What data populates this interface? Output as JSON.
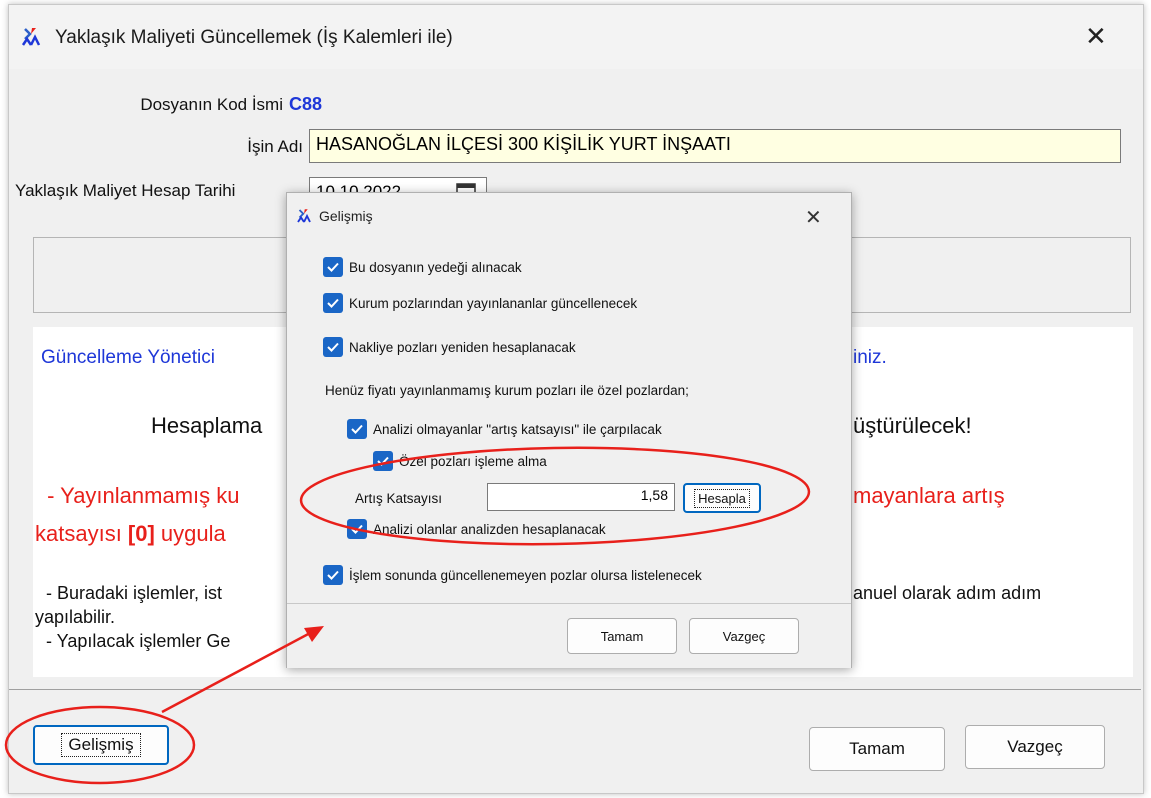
{
  "main_window": {
    "title": "Yaklaşık Maliyeti Güncellemek (İş Kalemleri ile)",
    "close_symbol": "✕",
    "fields": {
      "code_label": "Dosyanın Kod İsmi",
      "code_value": "C88",
      "name_label": "İşin Adı",
      "name_value": "HASANOĞLAN İLÇESİ 300 KİŞİLİK YURT İNŞAATI",
      "date_label": "Yaklaşık Maliyet Hesap Tarihi",
      "date_value": "10.10.2022"
    },
    "info": {
      "line1": "Güncelleme Yönetici",
      "line1_end": "iniz.",
      "line2": "Hesaplama",
      "line2_end": "üştürülecek!",
      "line3": " - Yayınlanmamış ku",
      "line3_end": "mayanlara artış",
      "line4_a": "katsayısı ",
      "line4_b": "[0]",
      "line4_c": " uygula",
      "line5": " - Buradaki işlemler, ist",
      "line5_end": "anuel olarak adım adım",
      "line6": "yapılabilir.",
      "line7": " - Yapılacak işlemler Ge"
    },
    "buttons": {
      "advanced": "Gelişmiş",
      "ok": "Tamam",
      "cancel": "Vazgeç"
    }
  },
  "dialog": {
    "title": "Gelişmiş",
    "close_symbol": "✕",
    "checkboxes": {
      "backup": "Bu dosyanın yedeği alınacak",
      "update_published": "Kurum pozlarından yayınlananlar güncellenecek",
      "recalc_transport": "Nakliye pozları yeniden hesaplanacak",
      "multiply_no_analysis": "Analizi olmayanlar \"artış katsayısı\" ile çarpılacak",
      "skip_custom": "Özel pozları işleme alma",
      "from_analysis": "Analizi olanlar analizden hesaplanacak",
      "list_failed": "İşlem sonunda güncellenemeyen pozlar olursa listelenecek"
    },
    "section_label": "Henüz fiyatı yayınlanmamış kurum pozları ile özel pozlardan;",
    "coefficient": {
      "label": "Artış Katsayısı",
      "value": "1,58",
      "calc_button": "Hesapla"
    },
    "buttons": {
      "ok": "Tamam",
      "cancel": "Vazgeç"
    }
  },
  "colors": {
    "accent_blue": "#1e37d8",
    "annotation_red": "#e8201b",
    "checkbox_blue": "#1a66c6"
  }
}
